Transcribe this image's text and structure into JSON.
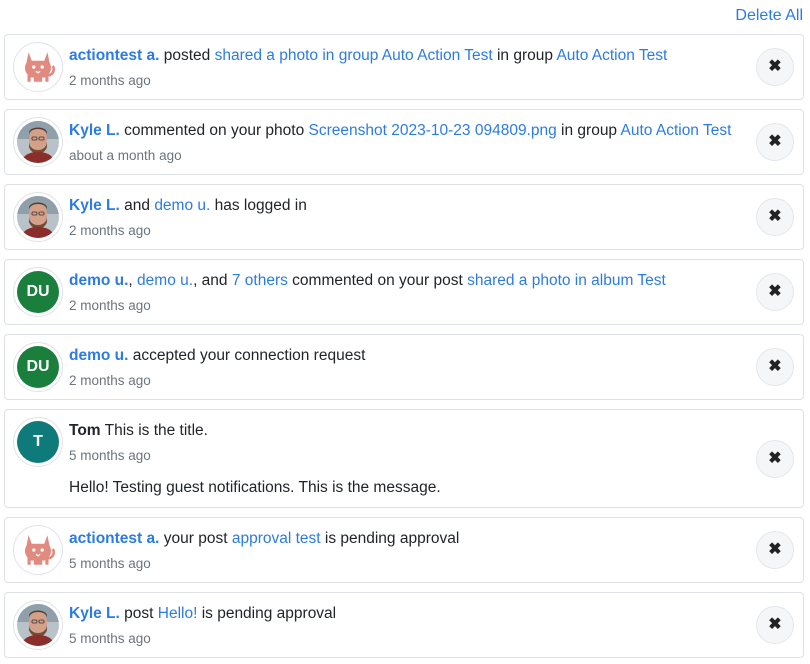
{
  "header": {
    "delete_all": "Delete All"
  },
  "icons": {
    "close": "✖",
    "cat": "cat-icon",
    "user_photo": "user-photo-icon"
  },
  "colors": {
    "link": "#2c7be5",
    "du_avatar": "#1a7f3c",
    "t_avatar": "#0f7a7a",
    "cat": "#e08a80"
  },
  "notifications": [
    {
      "actor": "actiontest a.",
      "text1": " posted ",
      "link1": "shared a photo in group Auto Action Test",
      "text2": " in group ",
      "link2": "Auto Action Test",
      "time": "2 months ago"
    },
    {
      "actor": "Kyle L.",
      "text1": " commented on your photo ",
      "link1": "Screenshot 2023-10-23 094809.png",
      "text2": " in group ",
      "link2": "Auto Action Test",
      "time": "about a month ago"
    },
    {
      "actor": "Kyle L.",
      "text1": " and ",
      "link1": "demo u.",
      "text2": " has logged in",
      "time": "2 months ago"
    },
    {
      "avatar_initials": "DU",
      "actor": "demo u.",
      "text1": ", ",
      "link1": "demo u.",
      "text2": ", and ",
      "link2": "7 others",
      "text3": " commented on your post ",
      "link3": "shared a photo in album Test",
      "time": "2 months ago"
    },
    {
      "avatar_initials": "DU",
      "actor": "demo u.",
      "text1": " accepted your connection request",
      "time": "2 months ago"
    },
    {
      "avatar_initials": "T",
      "actor": "Tom",
      "text1": " This is the title.",
      "time": "5 months ago",
      "message": "Hello! Testing guest notifications. This is the message."
    },
    {
      "actor": "actiontest a.",
      "text1": " your post ",
      "link1": "approval test",
      "text2": " is pending approval",
      "time": "5 months ago"
    },
    {
      "actor": "Kyle L.",
      "text1": " post ",
      "link1": "Hello!",
      "text2": " is pending approval",
      "time": "5 months ago"
    }
  ]
}
